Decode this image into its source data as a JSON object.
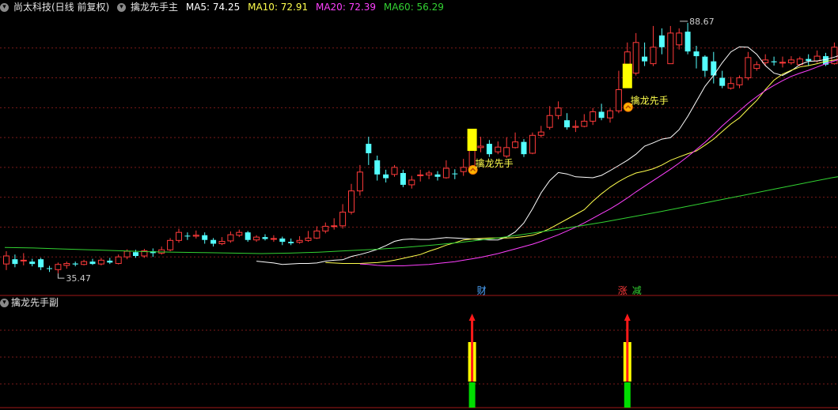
{
  "header": {
    "stock_label": "尚太科技(日线 前复权)",
    "indicator_name": "擒龙先手主",
    "ma5_label": "MA5: 74.25",
    "ma10_label": "MA10: 72.91",
    "ma20_label": "MA20: 72.39",
    "ma60_label": "MA60: 56.29"
  },
  "sub_header": {
    "indicator_name": "擒龙先手副"
  },
  "colors": {
    "background": "#000000",
    "up": "#ff3a3a",
    "down": "#54ffff",
    "ma5": "#ffffff",
    "ma10": "#ffff4d",
    "ma20": "#ff40ff",
    "ma60": "#32d232",
    "signal_bar": "#ffff00",
    "grid": "#7a1a1a"
  },
  "chart_data": {
    "type": "candlestick",
    "ylim": [
      33.5,
      90.5
    ],
    "high_label": "88.67",
    "low_label": "35.47",
    "candles": [
      [
        37.5,
        39.2,
        40.2,
        36.2
      ],
      [
        38.5,
        37.5,
        39.5,
        36.8
      ],
      [
        38.3,
        38.3,
        39.8,
        37.2
      ],
      [
        38.0,
        37.5,
        38.6,
        37.0
      ],
      [
        38.5,
        36.8,
        38.8,
        36.2
      ],
      [
        36.6,
        36.5,
        37.1,
        35.8
      ],
      [
        36.3,
        37.4,
        37.8,
        35.5
      ],
      [
        37.2,
        37.6,
        38.0,
        36.5
      ],
      [
        37.6,
        37.4,
        38.0,
        37.0
      ],
      [
        37.4,
        38.0,
        38.4,
        37.2
      ],
      [
        38.0,
        37.5,
        38.6,
        37.3
      ],
      [
        37.5,
        38.3,
        38.8,
        37.2
      ],
      [
        38.2,
        37.8,
        38.8,
        37.5
      ],
      [
        37.6,
        39.0,
        39.5,
        37.4
      ],
      [
        39.0,
        40.2,
        40.6,
        38.5
      ],
      [
        40.0,
        39.2,
        40.5,
        38.8
      ],
      [
        39.2,
        40.3,
        40.7,
        38.8
      ],
      [
        40.2,
        39.8,
        40.8,
        39.0
      ],
      [
        39.8,
        40.5,
        41.2,
        39.5
      ],
      [
        40.5,
        42.5,
        43.0,
        40.2
      ],
      [
        42.5,
        44.2,
        45.0,
        42.0
      ],
      [
        43.5,
        43.4,
        44.2,
        42.6
      ],
      [
        43.4,
        43.6,
        44.6,
        42.9
      ],
      [
        43.6,
        42.6,
        44.2,
        41.8
      ],
      [
        42.6,
        41.8,
        43.0,
        41.2
      ],
      [
        41.8,
        42.3,
        43.2,
        41.5
      ],
      [
        42.4,
        43.7,
        44.4,
        42.0
      ],
      [
        43.6,
        44.2,
        44.8,
        43.2
      ],
      [
        44.2,
        42.6,
        44.5,
        42.2
      ],
      [
        42.6,
        43.2,
        43.6,
        42.2
      ],
      [
        43.2,
        42.8,
        43.8,
        42.5
      ],
      [
        42.8,
        42.9,
        43.6,
        42.2
      ],
      [
        42.9,
        42.2,
        43.3,
        41.5
      ],
      [
        42.2,
        41.9,
        42.9,
        41.5
      ],
      [
        42.1,
        42.5,
        43.4,
        41.8
      ],
      [
        42.5,
        43.0,
        44.5,
        42.2
      ],
      [
        43.0,
        44.5,
        45.5,
        42.8
      ],
      [
        44.5,
        45.5,
        46.3,
        44.0
      ],
      [
        45.5,
        45.6,
        47.2,
        44.8
      ],
      [
        45.6,
        48.5,
        50.2,
        45.0
      ],
      [
        48.5,
        53.0,
        54.5,
        48.0
      ],
      [
        53.0,
        57.0,
        58.5,
        52.0
      ],
      [
        63.0,
        61.0,
        64.5,
        58.5
      ],
      [
        59.5,
        56.5,
        60.5,
        55.2
      ],
      [
        56.5,
        55.7,
        57.5,
        54.8
      ],
      [
        56.5,
        58.0,
        58.5,
        56.0
      ],
      [
        56.8,
        54.3,
        57.5,
        53.8
      ],
      [
        54.3,
        55.3,
        56.2,
        53.5
      ],
      [
        56.3,
        56.4,
        57.5,
        55.0
      ],
      [
        56.4,
        56.8,
        57.3,
        55.5
      ],
      [
        56.5,
        56.0,
        57.2,
        55.2
      ],
      [
        55.8,
        57.8,
        59.5,
        55.6
      ],
      [
        56.7,
        56.6,
        57.6,
        55.5
      ],
      [
        57.1,
        58.0,
        59.8,
        56.2
      ],
      [
        58.0,
        62.2,
        63.2,
        57.8
      ],
      [
        62.2,
        62.5,
        64.5,
        61.2
      ],
      [
        63.0,
        60.8,
        63.8,
        60.2
      ],
      [
        61.3,
        62.3,
        63.5,
        60.8
      ],
      [
        60.4,
        62.2,
        64.4,
        60.0
      ],
      [
        62.2,
        63.4,
        65.4,
        62.0
      ],
      [
        63.4,
        60.8,
        64.0,
        60.2
      ],
      [
        61.0,
        64.8,
        65.4,
        60.8
      ],
      [
        64.8,
        65.5,
        66.8,
        64.3
      ],
      [
        66.5,
        69.0,
        71.0,
        66.0
      ],
      [
        69.0,
        70.6,
        72.0,
        68.2
      ],
      [
        68.0,
        66.5,
        69.5,
        66.0
      ],
      [
        66.5,
        66.7,
        68.0,
        65.5
      ],
      [
        66.7,
        67.8,
        69.3,
        66.5
      ],
      [
        67.8,
        69.8,
        70.6,
        67.0
      ],
      [
        69.8,
        68.5,
        71.5,
        68.0
      ],
      [
        68.5,
        70.0,
        70.5,
        67.5
      ],
      [
        70.0,
        74.5,
        78.5,
        69.5
      ],
      [
        75.5,
        82.5,
        84.5,
        75.0
      ],
      [
        78.0,
        84.5,
        86.5,
        77.5
      ],
      [
        81.5,
        80.5,
        84.5,
        79.5
      ],
      [
        80.0,
        83.5,
        88.0,
        79.5
      ],
      [
        86.0,
        83.5,
        87.5,
        82.0
      ],
      [
        80.0,
        86.5,
        88.0,
        80.0
      ],
      [
        84.0,
        86.5,
        87.5,
        83.0
      ],
      [
        86.8,
        82.6,
        88.67,
        82.0
      ],
      [
        82.6,
        81.6,
        83.8,
        79.0
      ],
      [
        81.5,
        78.5,
        81.8,
        77.2
      ],
      [
        80.5,
        77.5,
        82.5,
        75.8
      ],
      [
        77.0,
        75.3,
        78.5,
        74.8
      ],
      [
        74.8,
        75.8,
        77.2,
        74.5
      ],
      [
        75.5,
        77.0,
        77.5,
        74.8
      ],
      [
        77.0,
        81.3,
        82.5,
        76.5
      ],
      [
        79.0,
        79.8,
        80.5,
        78.5
      ],
      [
        80.2,
        80.8,
        82.0,
        79.5
      ],
      [
        80.5,
        80.3,
        81.5,
        79.6
      ],
      [
        80.2,
        80.3,
        81.5,
        79.2
      ],
      [
        80.2,
        80.8,
        81.6,
        79.8
      ],
      [
        79.8,
        81.0,
        81.5,
        79.5
      ],
      [
        81.0,
        80.6,
        82.0,
        79.5
      ],
      [
        80.6,
        81.6,
        82.8,
        80.2
      ],
      [
        81.6,
        79.8,
        82.3,
        79.5
      ],
      [
        80.0,
        83.5,
        84.5,
        79.8
      ],
      [
        83.5,
        82.4,
        84.5,
        81.5
      ],
      [
        82.4,
        83.8,
        85.5,
        82.0
      ],
      [
        82.5,
        83.8,
        84.0,
        82.0
      ]
    ],
    "series": [
      {
        "name": "MA5",
        "values": [
          38.1,
          37.9,
          37.7,
          37.4,
          37.5,
          37.6,
          37.6,
          37.7,
          38.1,
          38.3,
          38.4,
          39.1,
          39.5,
          40.0,
          40.6,
          41.4,
          42.3,
          42.7,
          42.8,
          42.7,
          42.7,
          42.9,
          43.1,
          43.0,
          42.9,
          42.8,
          42.7,
          42.6,
          42.6,
          43.2,
          44.3,
          46.2,
          49.2,
          52.6,
          55.2,
          56.9,
          56.6,
          56.0,
          55.9,
          55.8,
          56.3,
          57.3,
          58.4,
          59.5,
          60.8,
          62.5,
          63.2,
          64.0,
          64.3,
          66.0,
          68.8,
          72.0,
          75.2,
          77.5,
          80.2,
          82.5,
          83.6,
          83.5,
          82.0,
          79.6,
          78.0,
          77.5,
          78.5,
          79.8,
          80.5,
          80.6,
          80.9,
          81.4,
          82.0,
          82.4,
          83.4
        ]
      },
      {
        "name": "MA10",
        "values": [
          37.8,
          37.7,
          37.6,
          37.6,
          37.6,
          37.7,
          37.8,
          38.0,
          38.3,
          38.7,
          39.1,
          39.5,
          40.2,
          40.8,
          41.5,
          42.0,
          42.6,
          42.8,
          42.9,
          43.0,
          43.0,
          43.0,
          43.1,
          43.3,
          43.6,
          44.2,
          45.0,
          46.0,
          47.0,
          48.0,
          49.0,
          50.8,
          52.4,
          53.8,
          55.0,
          56.0,
          56.8,
          57.2,
          57.7,
          58.5,
          59.5,
          60.2,
          60.9,
          61.5,
          62.7,
          64.0,
          65.6,
          67.2,
          68.5,
          70.4,
          72.2,
          74.5,
          76.5,
          77.8,
          78.6,
          79.3,
          79.6,
          80.0,
          80.5,
          80.8,
          81.0,
          81.5,
          82.2
        ]
      },
      {
        "name": "MA20",
        "values": [
          37.5,
          37.4,
          37.2,
          37.1,
          37.1,
          37.1,
          37.2,
          37.3,
          37.4,
          37.6,
          37.8,
          38.0,
          38.3,
          38.6,
          38.9,
          39.3,
          39.7,
          40.2,
          40.7,
          41.2,
          41.7,
          42.3,
          43.0,
          43.7,
          44.5,
          45.3,
          46.2,
          47.2,
          48.2,
          49.2,
          50.3,
          51.5,
          52.8,
          54.0,
          55.2,
          56.4,
          57.6,
          58.9,
          60.3,
          61.8,
          63.3,
          65.0,
          66.8,
          68.4,
          70.0,
          71.6,
          73.0,
          74.3,
          75.4,
          76.4,
          77.3,
          78.0,
          78.6,
          79.3,
          80.0,
          80.6,
          81.2,
          81.8,
          82.5
        ]
      },
      {
        "name": "MA60",
        "values": [
          41.0,
          40.9,
          40.7,
          40.5,
          40.3,
          40.1,
          40.0,
          39.9,
          39.8,
          39.7,
          39.8,
          40.0,
          40.3,
          40.6,
          41.0,
          41.5,
          42.1,
          42.8,
          43.6,
          44.5,
          45.4,
          46.4,
          47.5,
          48.6,
          49.8,
          51.0,
          52.2,
          53.4,
          54.6,
          55.8,
          56.8
        ]
      }
    ],
    "signals": [
      {
        "index": 54,
        "label": "擒龙先手",
        "bar_low": 61.5,
        "bar_high": 66.2
      },
      {
        "index": 72,
        "label": "擒龙先手",
        "bar_low": 74.8,
        "bar_high": 80.0
      }
    ],
    "sub_markers": [
      {
        "index": 54,
        "tags": [
          "财"
        ]
      },
      {
        "index": 72,
        "tags": [
          "涨",
          "减"
        ]
      }
    ]
  }
}
